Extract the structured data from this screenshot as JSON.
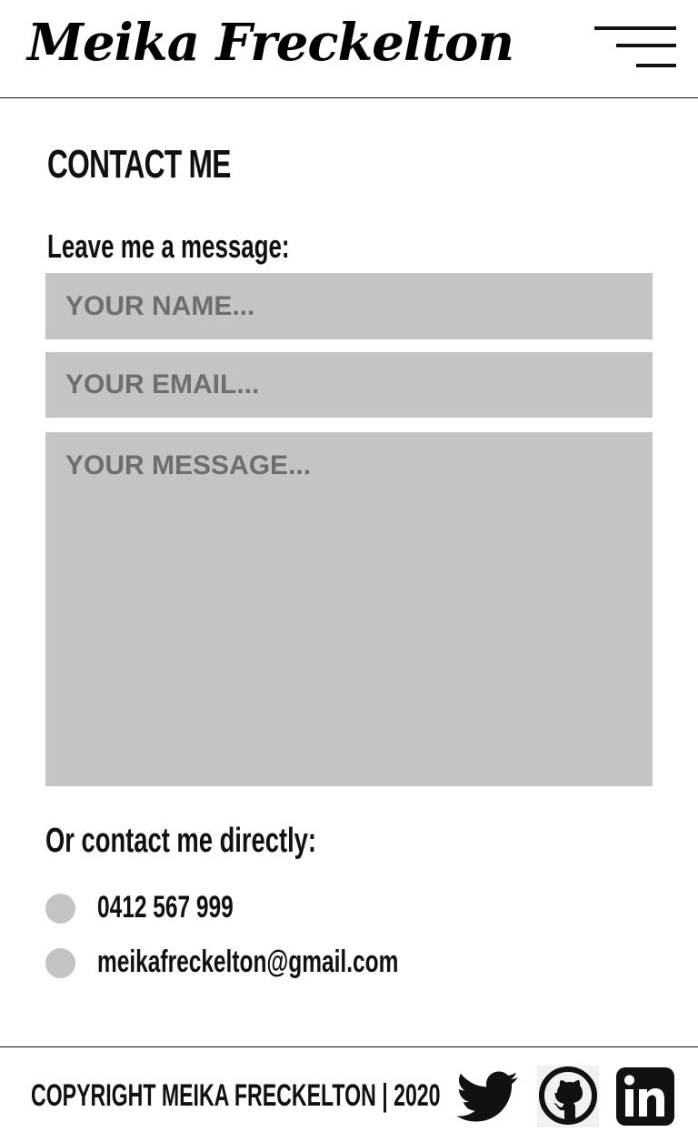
{
  "header": {
    "logo": "Meika Freckelton",
    "menu_icon": "hamburger-menu-icon"
  },
  "contact": {
    "title": "CONTACT ME",
    "lead": "Leave me a message:",
    "name_placeholder": "Your name...",
    "email_placeholder": "Your email...",
    "message_placeholder": "Your message...",
    "direct_heading": "Or contact me directly:",
    "phone": "0412 567 999",
    "email": "meikafreckelton@gmail.com",
    "bullet_color": "#c4c4c4"
  },
  "footer": {
    "copyright": "COPYRIGHT MEIKA FRECKELTON | 2020",
    "social": [
      "twitter-icon",
      "github-icon",
      "linkedin-icon"
    ]
  },
  "colors": {
    "field_background": "#c4c4c4",
    "text": "#111111",
    "background": "#ffffff"
  }
}
